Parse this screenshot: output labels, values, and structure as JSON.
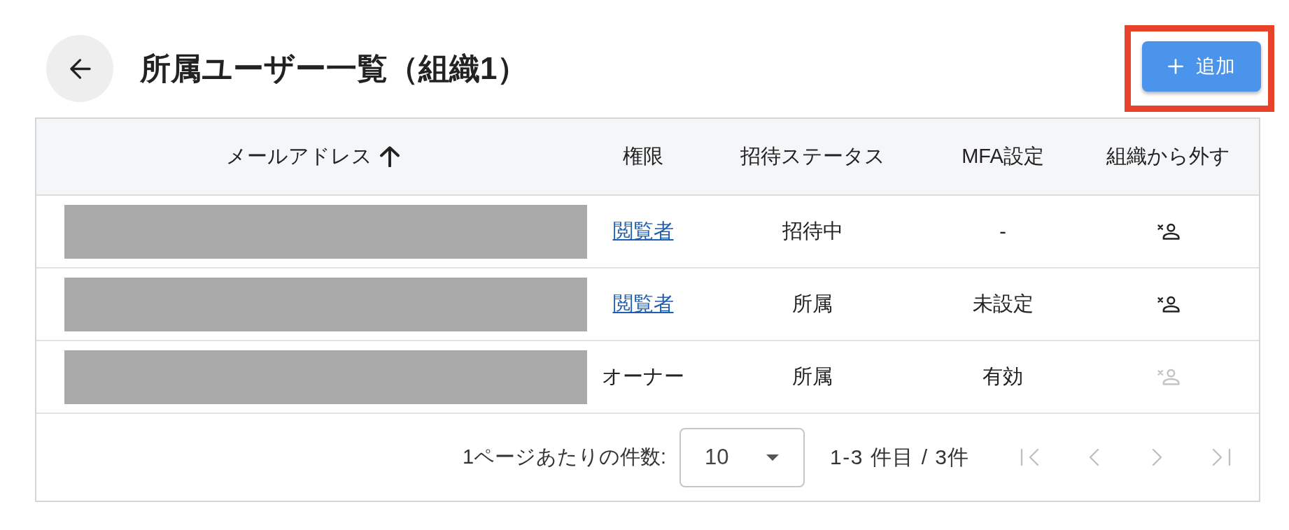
{
  "title": "所属ユーザー一覧（組織1）",
  "add_button": {
    "label": "追加",
    "highlighted": true
  },
  "table": {
    "columns": [
      {
        "label": "メールアドレス",
        "sorted_ascending": true
      },
      {
        "label": "権限",
        "sorted_ascending": false
      },
      {
        "label": "招待ステータス",
        "sorted_ascending": false
      },
      {
        "label": "MFA設定",
        "sorted_ascending": false
      },
      {
        "label": "組織から外す",
        "sorted_ascending": false
      }
    ],
    "rows": [
      {
        "email_redacted": true,
        "role": {
          "text": "閲覧者",
          "kind": "link"
        },
        "invitation_status": "招待中",
        "mfa": "-",
        "remove_disabled": false
      },
      {
        "email_redacted": true,
        "role": {
          "text": "閲覧者",
          "kind": "link"
        },
        "invitation_status": "所属",
        "mfa": "未設定",
        "remove_disabled": false
      },
      {
        "email_redacted": true,
        "role": {
          "text": "オーナー",
          "kind": "text"
        },
        "invitation_status": "所属",
        "mfa": "有効",
        "remove_disabled": true
      }
    ]
  },
  "pagination": {
    "rows_per_page_label": "1ページあたりの件数:",
    "rows_per_page": "10",
    "range": "1-3 件目 / 3件",
    "nav_buttons": [
      {
        "kind": "first",
        "disabled": true
      },
      {
        "kind": "prev",
        "disabled": true
      },
      {
        "kind": "next",
        "disabled": true
      },
      {
        "kind": "last",
        "disabled": true
      }
    ]
  }
}
